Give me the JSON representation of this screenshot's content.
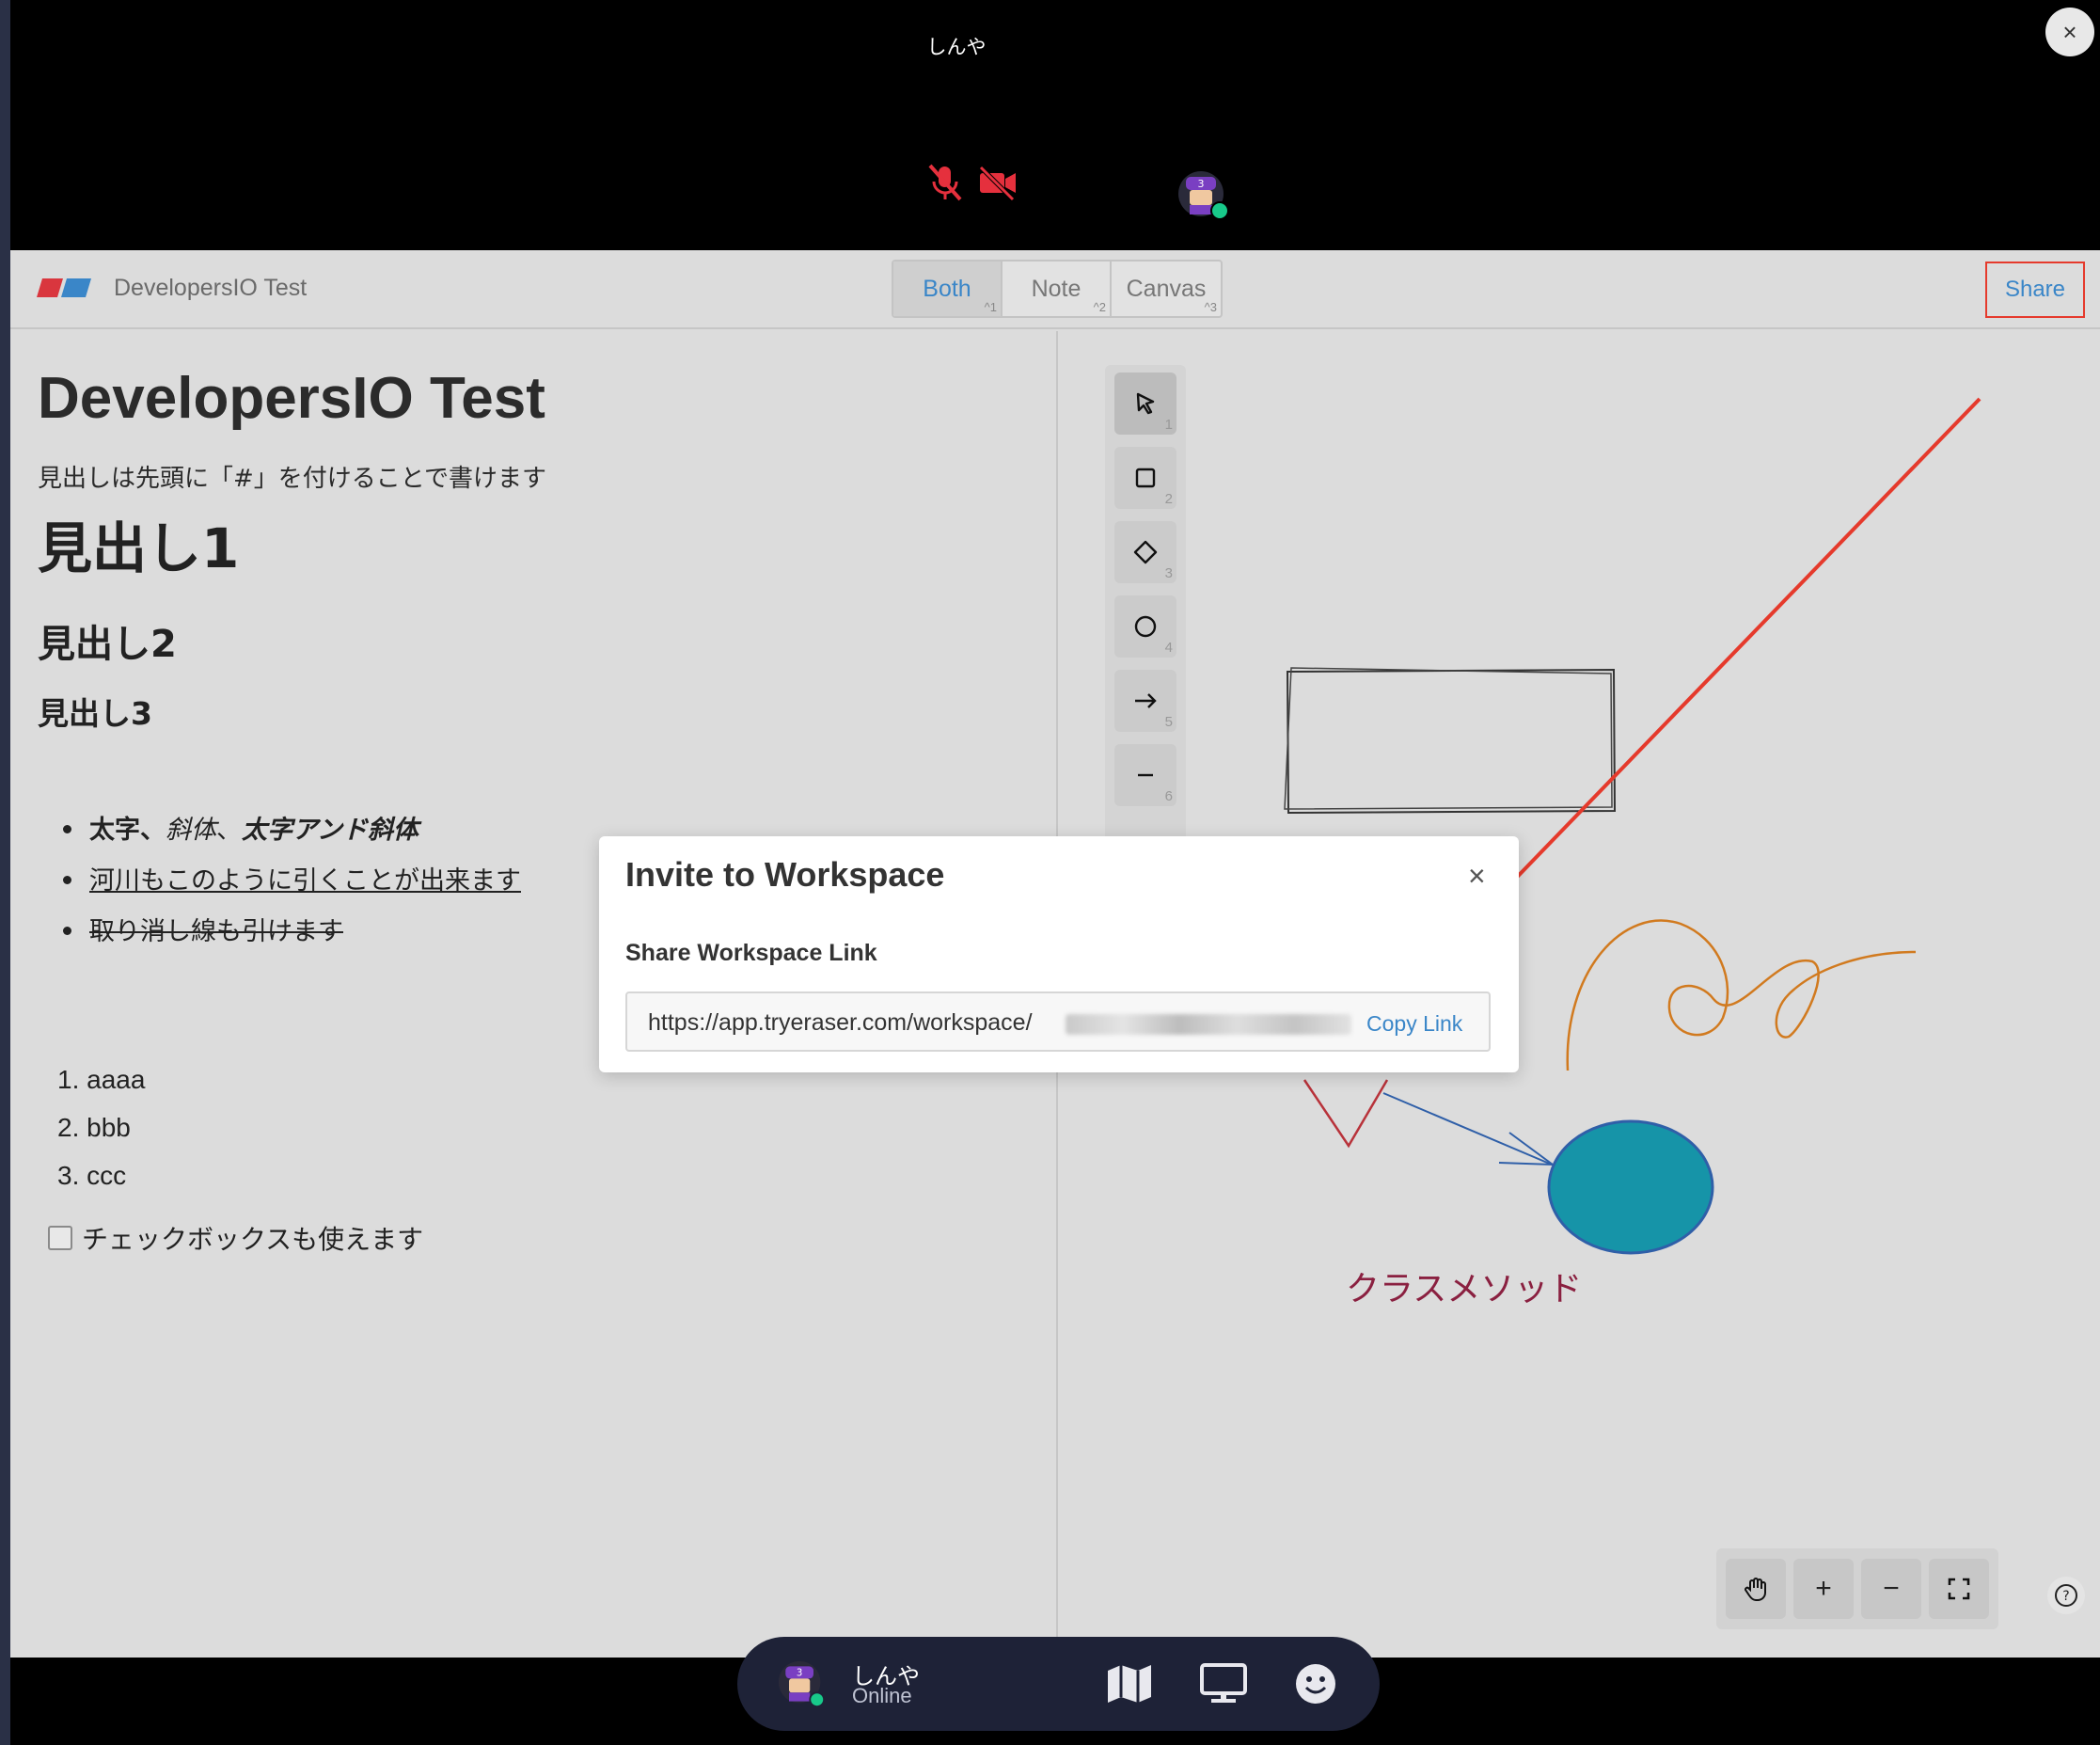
{
  "video": {
    "participant_name": "しんや",
    "close_symbol": "×"
  },
  "header": {
    "doc_title": "DevelopersIO Test",
    "view_tabs": [
      {
        "label": "Both",
        "key": "^1",
        "active": true
      },
      {
        "label": "Note",
        "key": "^2",
        "active": false
      },
      {
        "label": "Canvas",
        "key": "^3",
        "active": false
      }
    ],
    "share_label": "Share"
  },
  "note": {
    "title": "DevelopersIO Test",
    "intro": "見出しは先頭に「#」を付けることで書けます",
    "heading1": "見出し1",
    "heading2": "見出し2",
    "heading3": "見出し3",
    "bullets": {
      "bold": "太字",
      "sep1": "、",
      "italic": "斜体",
      "sep2": "、",
      "bold_italic": "太字アンド斜体",
      "underline": "河川もこのように引くことが出来ます",
      "strike": "取り消し線も引けます"
    },
    "ordered": [
      "1. aaaa",
      "2. bbb",
      "3. ccc"
    ],
    "checkbox_label": "チェックボックスも使えます"
  },
  "canvas": {
    "tool_keys": [
      "1",
      "2",
      "3",
      "4",
      "5",
      "6"
    ],
    "tool_icons": [
      "pointer-icon",
      "rectangle-icon",
      "diamond-icon",
      "ellipse-icon",
      "arrow-icon",
      "line-icon"
    ],
    "text_label": "クラスメソッド",
    "zoom_in": "+",
    "zoom_out": "−",
    "colors": {
      "orange": "#d17a1f",
      "teal": "#1694a8",
      "blue": "#2f5fa8",
      "red": "#b8323a",
      "label": "#8a2040",
      "annotation": "#e53a2c"
    }
  },
  "modal": {
    "title": "Invite to Workspace",
    "close_symbol": "×",
    "section_label": "Share Workspace Link",
    "link_prefix": "https://app.tryeraser.com/workspace/",
    "copy_label": "Copy Link"
  },
  "dock": {
    "user_name": "しんや",
    "status": "Online"
  }
}
